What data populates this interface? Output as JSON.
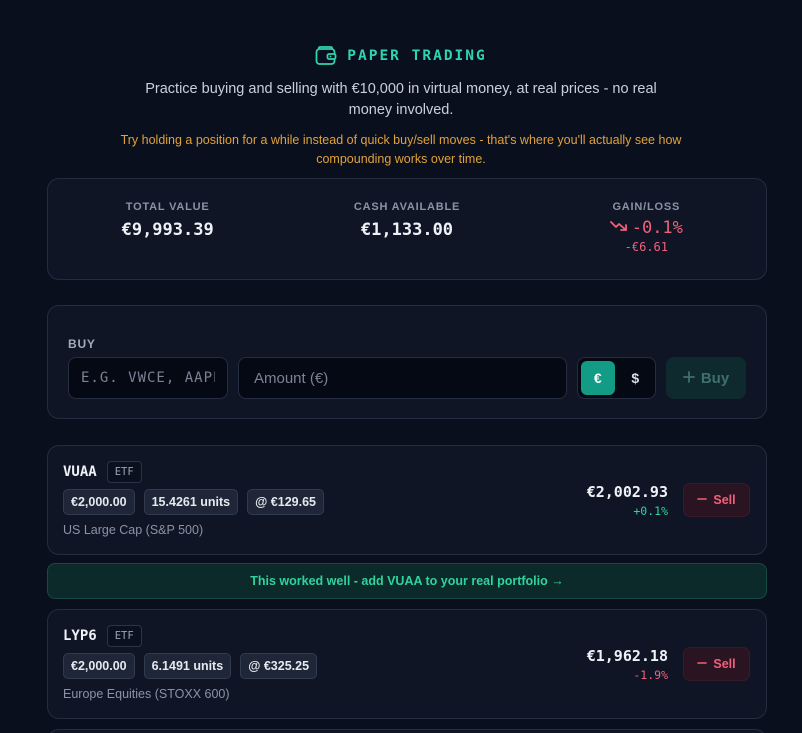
{
  "header": {
    "title": "PAPER TRADING",
    "subtitle": "Practice buying and selling with €10,000 in virtual money, at real prices - no real money involved.",
    "tip": "Try holding a position for a while instead of quick buy/sell moves - that's where you'll actually see how compounding works over time.",
    "icon": "wallet-icon",
    "accent_color": "#2dd4b0"
  },
  "summary": {
    "total_value": {
      "label": "TOTAL VALUE",
      "value": "€9,993.39"
    },
    "cash_available": {
      "label": "CASH AVAILABLE",
      "value": "€1,133.00"
    },
    "gain_loss": {
      "label": "GAIN/LOSS",
      "percent": "-0.1%",
      "absolute": "-€6.61",
      "icon": "trending-down-icon",
      "color": "#f0607a"
    }
  },
  "buy": {
    "label": "BUY",
    "ticker_placeholder": "E.G. VWCE, AAPL",
    "amount_placeholder": "Amount (€)",
    "currency_options": [
      "€",
      "$"
    ],
    "currency_selected": "€",
    "button_label": "Buy",
    "button_icon": "plus-icon"
  },
  "positions": [
    {
      "ticker": "VUAA",
      "type": "ETF",
      "invested": "€2,000.00",
      "units": "15.4261 units",
      "price": "@ €129.65",
      "description": "US Large Cap (S&P 500)",
      "value": "€2,002.93",
      "change": "+0.1%",
      "sell_label": "Sell"
    },
    {
      "ticker": "LYP6",
      "type": "ETF",
      "invested": "€2,000.00",
      "units": "6.1491 units",
      "price": "@ €325.25",
      "description": "Europe Equities (STOXX 600)",
      "value": "€1,962.18",
      "change": "-1.9%",
      "sell_label": "Sell"
    }
  ],
  "banner": {
    "text": "This worked well - add VUAA to your real portfolio →",
    "color": "#2fd39e"
  }
}
